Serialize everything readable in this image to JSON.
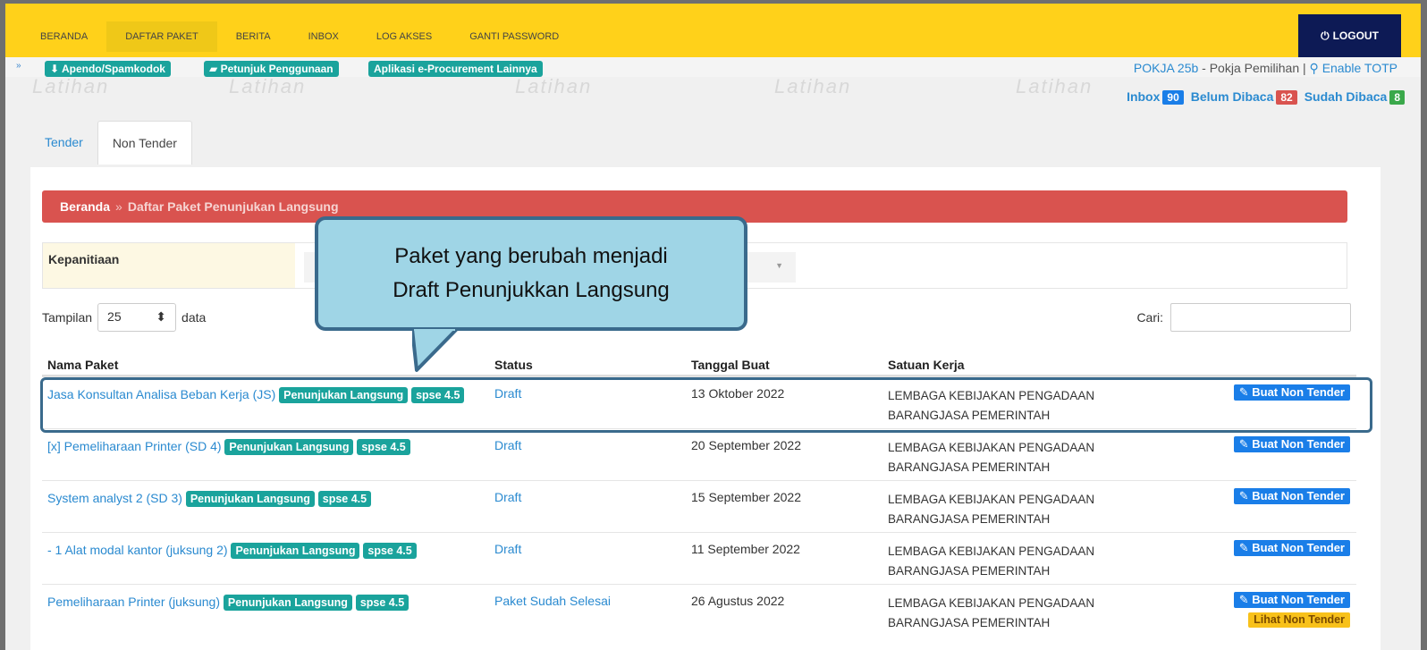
{
  "nav": {
    "items": [
      "BERANDA",
      "DAFTAR PAKET",
      "BERITA",
      "INBOX",
      "LOG AKSES",
      "GANTI PASSWORD"
    ],
    "active": "DAFTAR PAKET",
    "logout": "LOGOUT"
  },
  "subbar": {
    "apendo": "Apendo/Spamkodok",
    "petunjuk": "Petunjuk Penggunaan",
    "aplikasi": "Aplikasi e-Procurement Lainnya",
    "pokja": "POKJA 25b",
    "pokja_role": " - Pokja Pemilihan | ",
    "enable_totp": "Enable TOTP"
  },
  "inbox": {
    "inbox_label": "Inbox",
    "inbox_count": "90",
    "belum_label": "Belum Dibaca",
    "belum_count": "82",
    "sudah_label": "Sudah Dibaca",
    "sudah_count": "8"
  },
  "watermark": "Latihan",
  "tabs": [
    "Tender",
    "Non Tender"
  ],
  "breadcrumb": {
    "home": "Beranda",
    "sep": "»",
    "current": "Daftar Paket Penunjukan Langsung"
  },
  "filter": {
    "label": "Kepanitiaan"
  },
  "tampilan": {
    "label": "Tampilan",
    "value": "25",
    "suffix": "data"
  },
  "search": {
    "label": "Cari:"
  },
  "table": {
    "headers": [
      "Nama Paket",
      "Status",
      "Tanggal Buat",
      "Satuan Kerja"
    ],
    "rows": [
      {
        "name": "Jasa Konsultan Analisa Beban Kerja (JS)",
        "badge1": "Penunjukan Langsung",
        "badge2": "spse 4.5",
        "status": "Draft",
        "tanggal": "13 Oktober 2022",
        "satker1": "LEMBAGA KEBIJAKAN PENGADAAN",
        "satker2": "BARANGJASA PEMERINTAH",
        "btn": "Buat Non Tender"
      },
      {
        "name": "[x] Pemeliharaan Printer (SD 4)",
        "badge1": "Penunjukan Langsung",
        "badge2": "spse 4.5",
        "status": "Draft",
        "tanggal": "20 September 2022",
        "satker1": "LEMBAGA KEBIJAKAN PENGADAAN",
        "satker2": "BARANGJASA PEMERINTAH",
        "btn": "Buat Non Tender"
      },
      {
        "name": "System analyst 2 (SD 3)",
        "badge1": "Penunjukan Langsung",
        "badge2": "spse 4.5",
        "status": "Draft",
        "tanggal": "15 September 2022",
        "satker1": "LEMBAGA KEBIJAKAN PENGADAAN",
        "satker2": "BARANGJASA PEMERINTAH",
        "btn": "Buat Non Tender"
      },
      {
        "name": "- 1 Alat modal kantor (juksung 2)",
        "badge1": "Penunjukan Langsung",
        "badge2": "spse 4.5",
        "status": "Draft",
        "tanggal": "11 September 2022",
        "satker1": "LEMBAGA KEBIJAKAN PENGADAAN",
        "satker2": "BARANGJASA PEMERINTAH",
        "btn": "Buat Non Tender"
      },
      {
        "name": "Pemeliharaan Printer (juksung)",
        "badge1": "Penunjukan Langsung",
        "badge2": "spse 4.5",
        "status": "Paket Sudah Selesai",
        "tanggal": "26 Agustus 2022",
        "satker1": "LEMBAGA KEBIJAKAN PENGADAAN",
        "satker2": "BARANGJASA PEMERINTAH",
        "btn": "Buat Non Tender",
        "btn2": "Lihat Non Tender"
      }
    ]
  },
  "callout": {
    "line1": "Paket yang berubah menjadi",
    "line2": "Draft Penunjukkan Langsung"
  },
  "colors": {
    "nav": "#ffd11a",
    "logout": "#0d1a55",
    "crumb": "#d9534f",
    "badge": "#1aa39c",
    "button": "#1a7ee8",
    "callout": "#9fd5e6"
  }
}
